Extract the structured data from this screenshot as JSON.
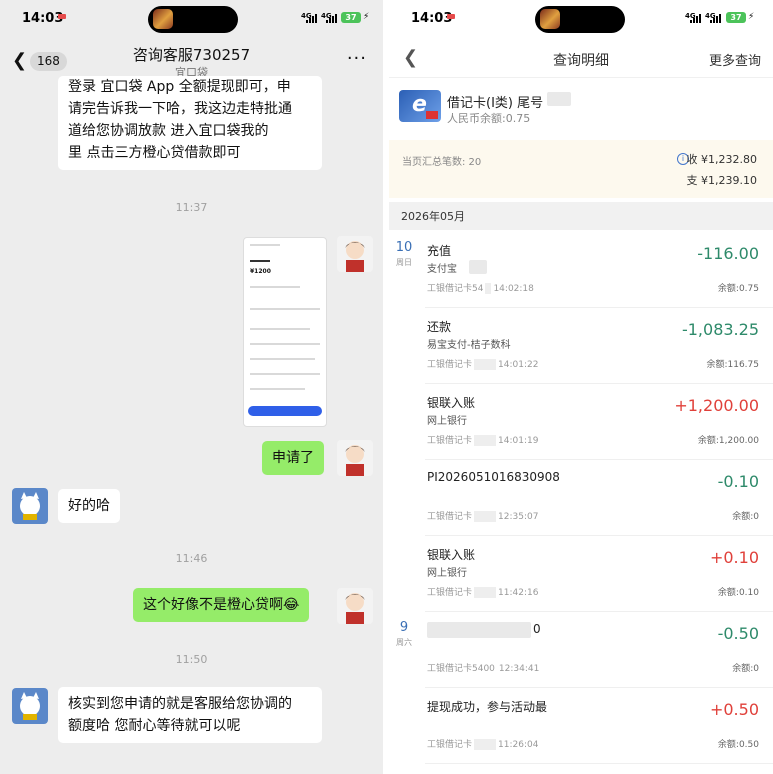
{
  "status_bar": {
    "time": "14:03",
    "network_1": "4G",
    "network_2": "4G",
    "battery": "37"
  },
  "chat": {
    "back_count": "168",
    "title": "咨询客服730257",
    "subtitle": "宜口袋",
    "messages": [
      {
        "side": "left",
        "type": "text",
        "text_lines": [
          "登录 宜口袋 App 全额提现即可，申",
          "请完告诉我一下哈，我这边走特批通",
          "道给您协调放款    进入宜口袋我的",
          "里 点击三方橙心贷借款即可"
        ]
      },
      {
        "type": "time",
        "text": "11:37"
      },
      {
        "side": "right",
        "type": "image",
        "caption": "¥1200"
      },
      {
        "side": "right",
        "type": "text",
        "text": "申请了"
      },
      {
        "side": "left",
        "type": "text",
        "text": "好的哈"
      },
      {
        "type": "time",
        "text": "11:46"
      },
      {
        "side": "right",
        "type": "text",
        "text": "这个好像不是橙心贷啊😂"
      },
      {
        "type": "time",
        "text": "11:50"
      },
      {
        "side": "left",
        "type": "text",
        "text_lines": [
          "核实到您申请的就是客服给您协调的",
          "额度哈  您耐心等待就可以呢"
        ]
      }
    ]
  },
  "bank": {
    "title": "查询明细",
    "more_query": "更多查询",
    "card_name": "借记卡(Ⅰ类) 尾号",
    "card_balance": "人民币余额:0.75",
    "summary_count": "当页汇总笔数: 20",
    "summary_in": "收 ¥1,232.80",
    "summary_out": "支 ¥1,239.10",
    "month": "2026年05月",
    "colors": {
      "income": "#e0403a",
      "expense": "#2e8a6a",
      "accent": "#3a6fb5"
    },
    "transactions": [
      {
        "day": "10",
        "weekday": "周日",
        "title": "充值",
        "sub": "支付宝",
        "meta": "工银借记卡54",
        "time": "14:02:18",
        "amount": "-116.00",
        "balance": "余额:0.75"
      },
      {
        "title": "还款",
        "sub": "易宝支付-桔子数科",
        "meta": "工银借记卡",
        "time": "14:01:22",
        "amount": "-1,083.25",
        "balance": "余额:116.75"
      },
      {
        "title": "银联入账",
        "sub": "网上银行",
        "meta": "工银借记卡",
        "time": "14:01:19",
        "amount": "+1,200.00",
        "balance": "余额:1,200.00"
      },
      {
        "title": "PI2026051016830908",
        "sub": "",
        "meta": "工银借记卡",
        "time": "12:35:07",
        "amount": "-0.10",
        "balance": "余额:0"
      },
      {
        "title": "银联入账",
        "sub": "网上银行",
        "meta": "工银借记卡",
        "time": "11:42:16",
        "amount": "+0.10",
        "balance": "余额:0.10"
      },
      {
        "day": "9",
        "weekday": "周六",
        "title": "0",
        "sub": "",
        "meta": "工银借记卡5400",
        "time": "12:34:41",
        "amount": "-0.50",
        "balance": "余额:0"
      },
      {
        "title": "提现成功，参与活动最",
        "sub": "",
        "meta": "工银借记卡",
        "time": "11:26:04",
        "amount": "+0.50",
        "balance": "余额:0.50"
      }
    ]
  }
}
